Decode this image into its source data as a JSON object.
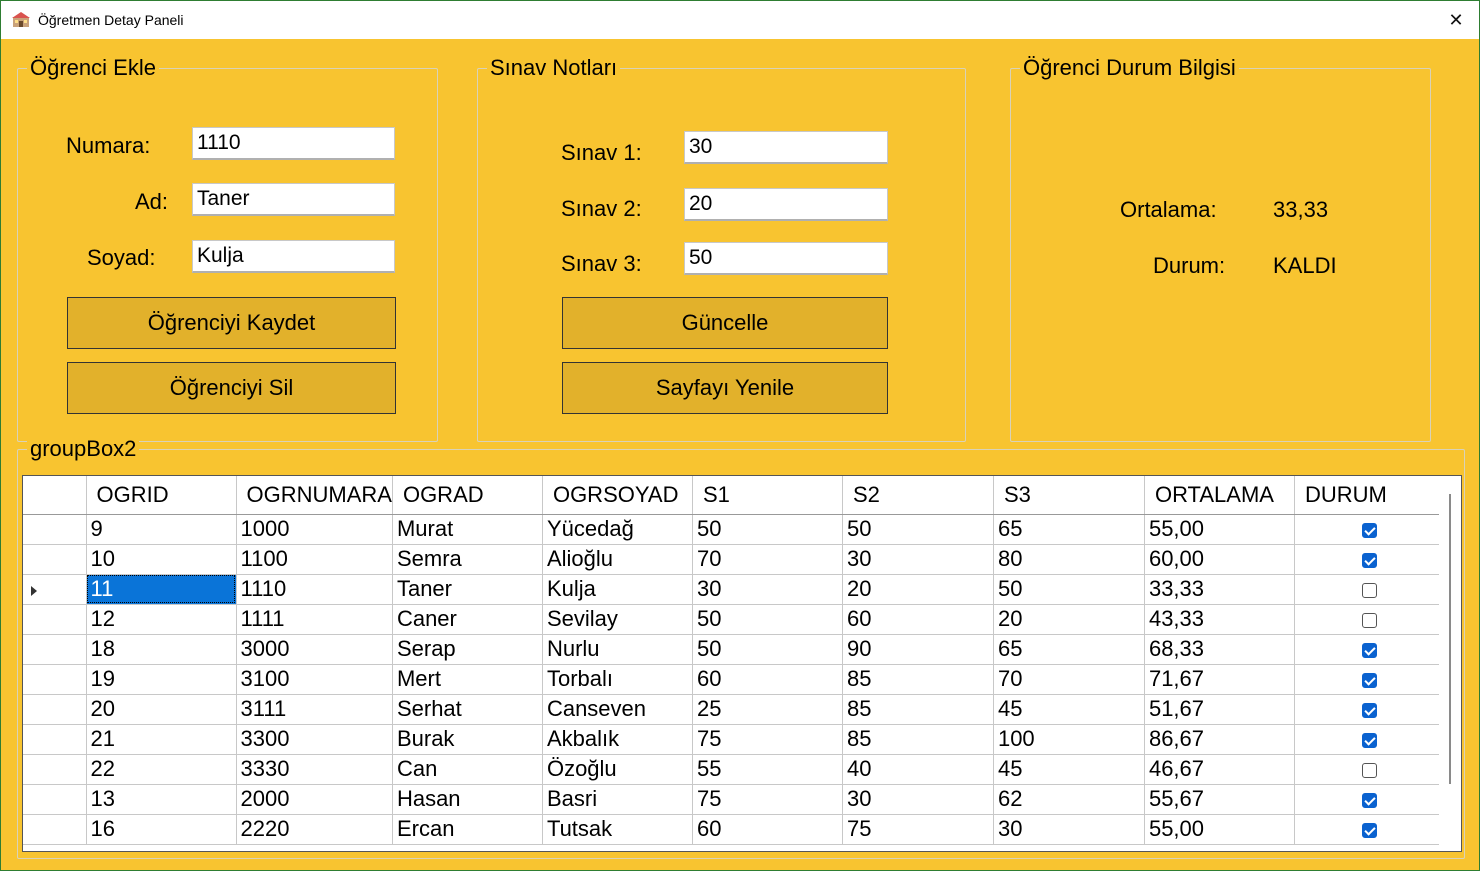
{
  "window": {
    "title": "Öğretmen Detay Paneli",
    "close_glyph": "✕"
  },
  "add_student": {
    "title": "Öğrenci Ekle",
    "numara_label": "Numara:",
    "numara_value": "1110",
    "ad_label": "Ad:",
    "ad_value": "Taner",
    "soyad_label": "Soyad:",
    "soyad_value": "Kulja",
    "save_button": "Öğrenciyi Kaydet",
    "delete_button": "Öğrenciyi Sil"
  },
  "exams": {
    "title": "Sınav Notları",
    "s1_label": "Sınav 1:",
    "s1_value": "30",
    "s2_label": "Sınav 2:",
    "s2_value": "20",
    "s3_label": "Sınav 3:",
    "s3_value": "50",
    "update_button": "Güncelle",
    "refresh_button": "Sayfayı Yenile"
  },
  "status": {
    "title": "Öğrenci Durum Bilgisi",
    "ortalama_label": "Ortalama:",
    "ortalama_value": "33,33",
    "durum_label": "Durum:",
    "durum_value": "KALDI"
  },
  "grid_box": {
    "title": "groupBox2"
  },
  "grid": {
    "columns": [
      "OGRID",
      "OGRNUMARA",
      "OGRAD",
      "OGRSOYAD",
      "S1",
      "S2",
      "S3",
      "ORTALAMA",
      "DURUM"
    ],
    "selected_row": 2,
    "rows": [
      [
        "9",
        "1000",
        "Murat",
        "Yücedağ",
        "50",
        "50",
        "65",
        "55,00",
        true
      ],
      [
        "10",
        "1100",
        "Semra",
        "Alioğlu",
        "70",
        "30",
        "80",
        "60,00",
        true
      ],
      [
        "11",
        "1110",
        "Taner",
        "Kulja",
        "30",
        "20",
        "50",
        "33,33",
        false
      ],
      [
        "12",
        "1111",
        "Caner",
        "Sevilay",
        "50",
        "60",
        "20",
        "43,33",
        false
      ],
      [
        "18",
        "3000",
        "Serap",
        "Nurlu",
        "50",
        "90",
        "65",
        "68,33",
        true
      ],
      [
        "19",
        "3100",
        "Mert",
        "Torbalı",
        "60",
        "85",
        "70",
        "71,67",
        true
      ],
      [
        "20",
        "3111",
        "Serhat",
        "Canseven",
        "25",
        "85",
        "45",
        "51,67",
        true
      ],
      [
        "21",
        "3300",
        "Burak",
        "Akbalık",
        "75",
        "85",
        "100",
        "86,67",
        true
      ],
      [
        "22",
        "3330",
        "Can",
        "Özoğlu",
        "55",
        "40",
        "45",
        "46,67",
        false
      ],
      [
        "13",
        "2000",
        "Hasan",
        "Basri",
        "75",
        "30",
        "62",
        "55,67",
        true
      ],
      [
        "16",
        "2220",
        "Ercan",
        "Tutsak",
        "60",
        "75",
        "30",
        "55,00",
        true
      ]
    ]
  },
  "colors": {
    "form_background": "#f8c430",
    "button_background": "#e2b12b",
    "selection": "#0a74d8",
    "checkbox_checked": "#0a62d0"
  }
}
